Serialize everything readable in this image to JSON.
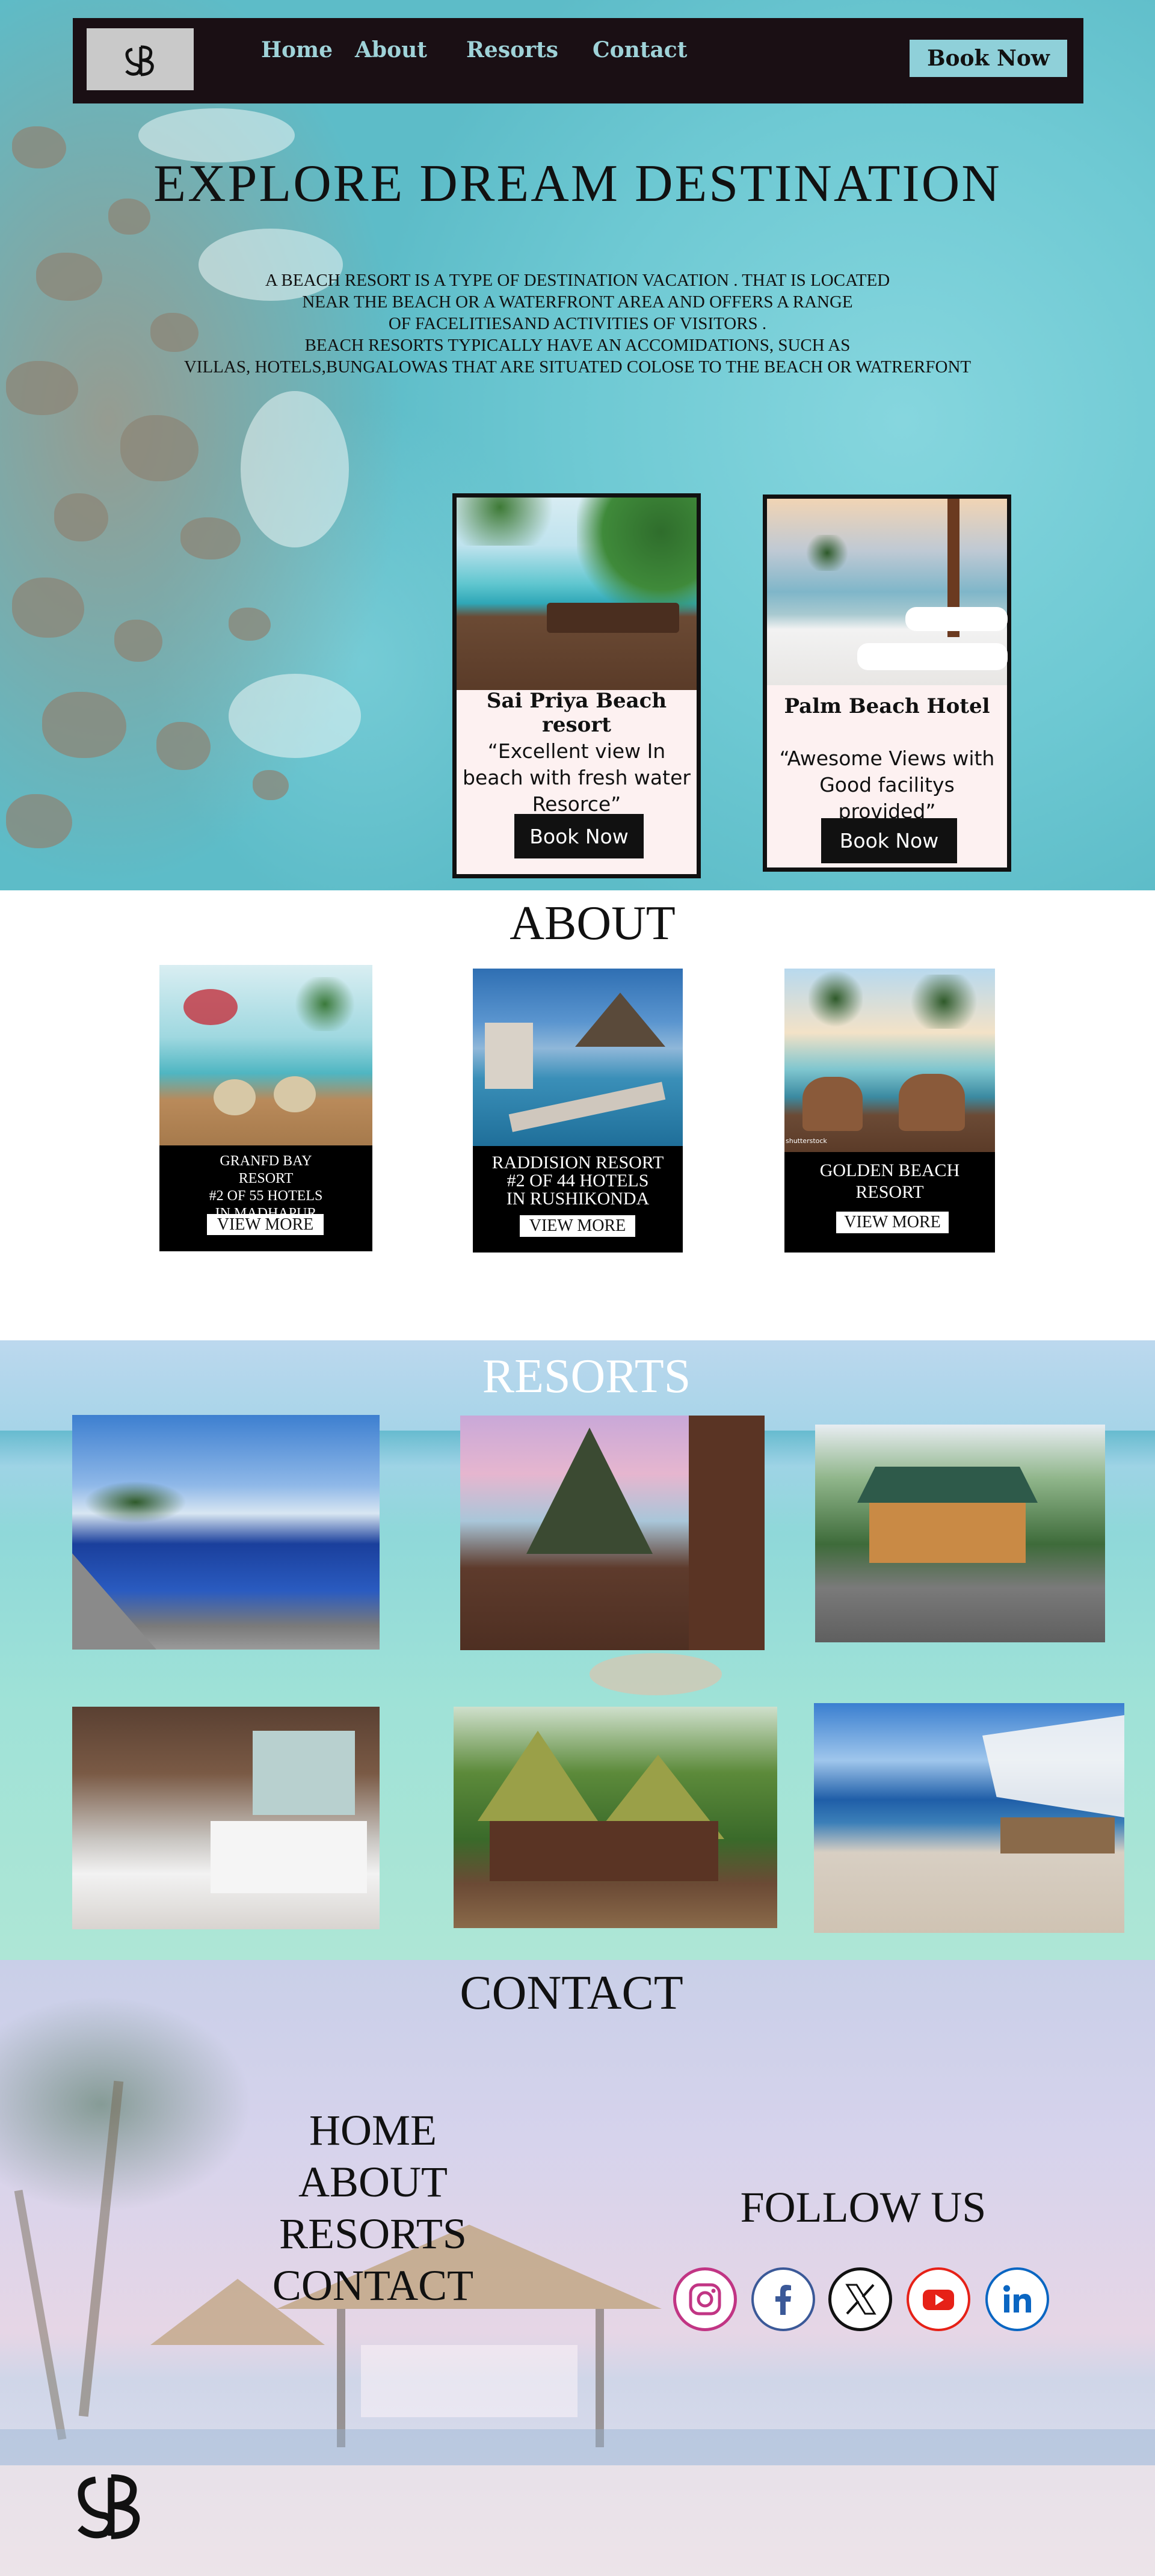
{
  "nav": {
    "logo_text": "SB",
    "links": [
      "Home",
      "About",
      "Resorts",
      "Contact"
    ],
    "book_label": "Book Now"
  },
  "hero": {
    "title": "EXPLORE  DREAM  DESTINATION",
    "description": "A BEACH RESORT  IS A TYPE OF DESTINATION VACATION . THAT IS LOCATED\nNEAR THE BEACH OR A WATERFRONT AREA AND OFFERS A RANGE\nOF FACELITIESAND ACTIVITIES OF VISITORS .\nBEACH RESORTS TYPICALLY HAVE AN ACCOMIDATIONS, SUCH AS\nVILLAS, HOTELS,BUNGALOWAS THAT ARE SITUATED COLOSE TO THE BEACH OR WATRERFONT",
    "cards": [
      {
        "title": "Sai Priya Beach resort",
        "quote": "“Excellent view In beach with fresh water Resorce”",
        "button": "Book Now"
      },
      {
        "title": "Palm Beach Hotel",
        "quote": "“Awesome Views with Good facilitys provided”",
        "button": "Book Now"
      }
    ]
  },
  "about": {
    "title": "ABOUT",
    "cards": [
      {
        "name": "GRANFD BAY\nRESORT\n#2 OF 55 HOTELS\nIN MADHAPUR",
        "button": "VIEW MORE"
      },
      {
        "name": "RADDISION RESORT\n#2 OF 44 HOTELS\nIN RUSHIKONDA",
        "button": "VIEW MORE"
      },
      {
        "name": "GOLDEN BEACH\nRESORT",
        "button": "VIEW MORE",
        "watermark": "shutterstock"
      }
    ]
  },
  "resorts": {
    "title": "RESORTS"
  },
  "contact": {
    "title": "CONTACT",
    "links": [
      "HOME",
      "ABOUT",
      "RESORTS",
      "CONTACT"
    ],
    "follow_title": "FOLLOW US",
    "socials": [
      {
        "icon": "instagram-icon",
        "color": "#c13584"
      },
      {
        "icon": "facebook-icon",
        "color": "#3b5998"
      },
      {
        "icon": "x-icon",
        "color": "#111111"
      },
      {
        "icon": "youtube-icon",
        "color": "#e62117"
      },
      {
        "icon": "linkedin-icon",
        "color": "#0a66c2"
      }
    ],
    "footer_logo": "SB"
  }
}
